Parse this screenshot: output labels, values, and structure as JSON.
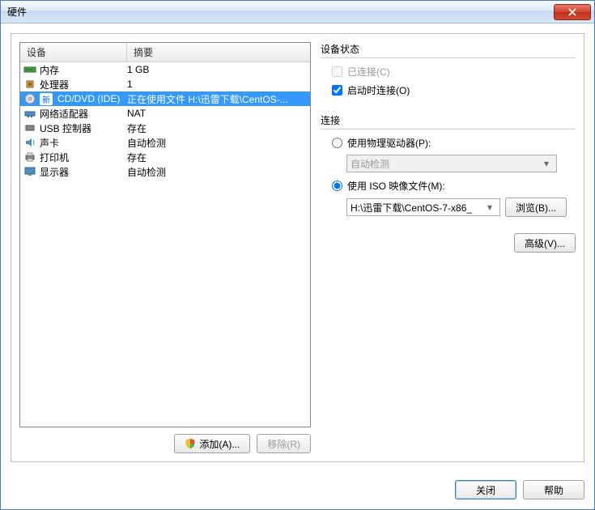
{
  "window": {
    "title": "硬件"
  },
  "table": {
    "headers": {
      "device": "设备",
      "summary": "摘要"
    },
    "rows": [
      {
        "icon": "memory",
        "name": "内存",
        "summary": "1 GB",
        "selected": false
      },
      {
        "icon": "cpu",
        "name": "处理器",
        "summary": "1",
        "selected": false
      },
      {
        "icon": "cd",
        "badge": "新",
        "name": "CD/DVD (IDE)",
        "summary": "正在使用文件 H:\\迅雷下载\\CentOS-...",
        "selected": true
      },
      {
        "icon": "network",
        "name": "网络适配器",
        "summary": "NAT",
        "selected": false
      },
      {
        "icon": "usb",
        "name": "USB 控制器",
        "summary": "存在",
        "selected": false
      },
      {
        "icon": "sound",
        "name": "声卡",
        "summary": "自动检测",
        "selected": false
      },
      {
        "icon": "printer",
        "name": "打印机",
        "summary": "存在",
        "selected": false
      },
      {
        "icon": "display",
        "name": "显示器",
        "summary": "自动检测",
        "selected": false
      }
    ]
  },
  "left_buttons": {
    "add": "添加(A)...",
    "remove": "移除(R)"
  },
  "device_status": {
    "title": "设备状态",
    "connected_label": "已连接(C)",
    "connected_checked": false,
    "connect_on_start_label": "启动时连接(O)",
    "connect_on_start_checked": true
  },
  "connection": {
    "title": "连接",
    "physical_label": "使用物理驱动器(P):",
    "physical_checked": false,
    "physical_combo": "自动检测",
    "iso_label": "使用 ISO 映像文件(M):",
    "iso_checked": true,
    "iso_path": "H:\\迅雷下载\\CentOS-7-x86_",
    "browse": "浏览(B)..."
  },
  "advanced": "高级(V)...",
  "footer": {
    "close": "关闭",
    "help": "帮助"
  }
}
